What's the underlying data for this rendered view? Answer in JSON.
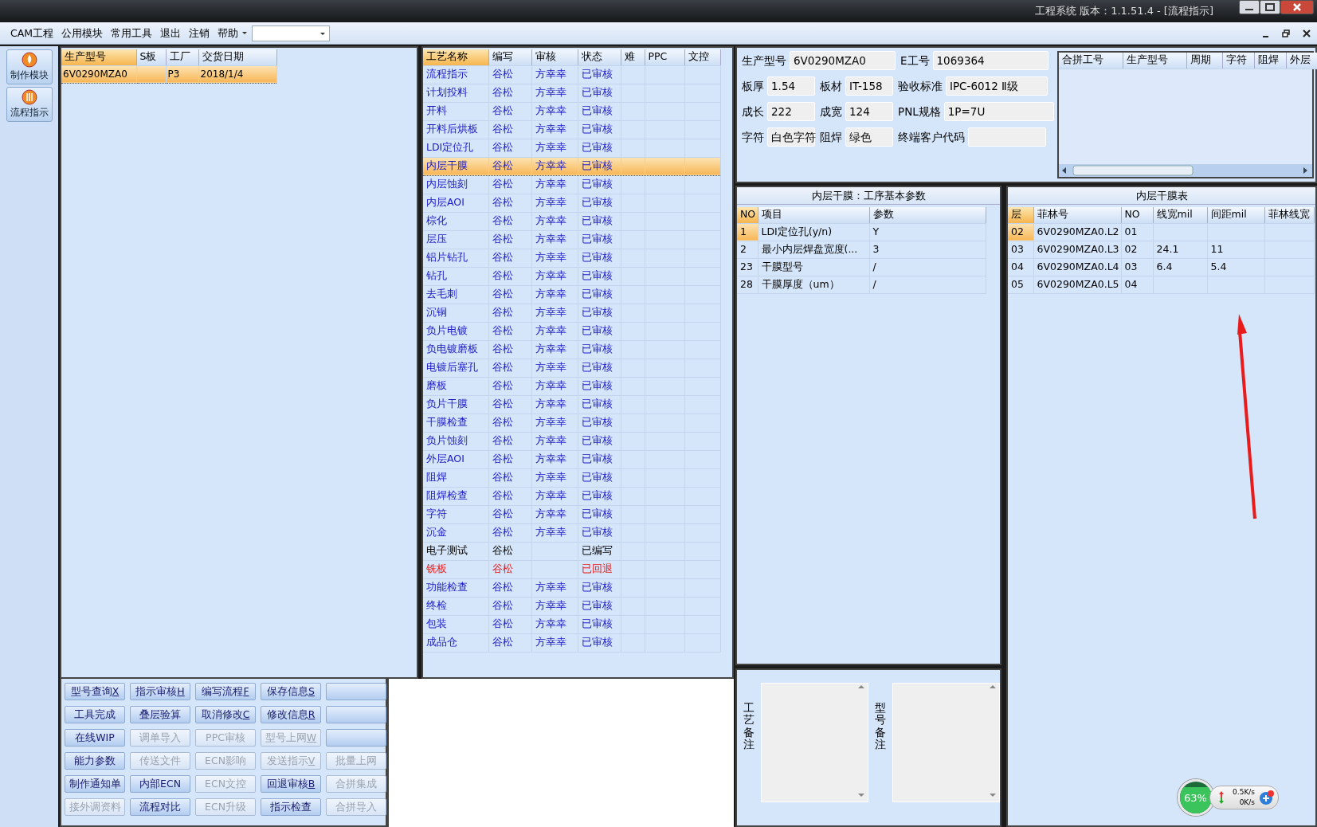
{
  "window": {
    "title": "工程系统   版本：1.1.51.4 - [流程指示]"
  },
  "menu": [
    {
      "label": "CAM工程"
    },
    {
      "label": "公用模块"
    },
    {
      "label": "常用工具"
    },
    {
      "label": "退出"
    },
    {
      "label": "注销"
    },
    {
      "label": "帮助"
    }
  ],
  "sidebar": [
    {
      "label": "制作模块"
    },
    {
      "label": "流程指示"
    }
  ],
  "orders": {
    "columns": [
      "生产型号",
      "S板",
      "工厂",
      "交货日期"
    ],
    "rows": [
      {
        "cells": [
          "6V0290MZA0",
          null,
          "P3",
          "2018/1/4"
        ],
        "selected": true
      }
    ]
  },
  "process": {
    "columns": [
      "工艺名称",
      "编写",
      "审核",
      "状态",
      "难",
      "PPC",
      "文控"
    ],
    "rows": [
      {
        "name": "流程指示",
        "author": "谷松",
        "reviewer": "方幸幸",
        "status": "已审核",
        "kind": "approved",
        "selected": false
      },
      {
        "name": "计划投料",
        "author": "谷松",
        "reviewer": "方幸幸",
        "status": "已审核",
        "kind": "approved",
        "selected": false
      },
      {
        "name": "开料",
        "author": "谷松",
        "reviewer": "方幸幸",
        "status": "已审核",
        "kind": "approved",
        "selected": false
      },
      {
        "name": "开料后烘板",
        "author": "谷松",
        "reviewer": "方幸幸",
        "status": "已审核",
        "kind": "approved",
        "selected": false
      },
      {
        "name": "LDI定位孔",
        "author": "谷松",
        "reviewer": "方幸幸",
        "status": "已审核",
        "kind": "approved",
        "selected": false
      },
      {
        "name": "内层干膜",
        "author": "谷松",
        "reviewer": "方幸幸",
        "status": "已审核",
        "kind": "approved",
        "selected": true
      },
      {
        "name": "内层蚀刻",
        "author": "谷松",
        "reviewer": "方幸幸",
        "status": "已审核",
        "kind": "approved",
        "selected": false
      },
      {
        "name": "内层AOI",
        "author": "谷松",
        "reviewer": "方幸幸",
        "status": "已审核",
        "kind": "approved",
        "selected": false
      },
      {
        "name": "棕化",
        "author": "谷松",
        "reviewer": "方幸幸",
        "status": "已审核",
        "kind": "approved",
        "selected": false
      },
      {
        "name": "层压",
        "author": "谷松",
        "reviewer": "方幸幸",
        "status": "已审核",
        "kind": "approved",
        "selected": false
      },
      {
        "name": "铝片钻孔",
        "author": "谷松",
        "reviewer": "方幸幸",
        "status": "已审核",
        "kind": "approved",
        "selected": false
      },
      {
        "name": "钻孔",
        "author": "谷松",
        "reviewer": "方幸幸",
        "status": "已审核",
        "kind": "approved",
        "selected": false
      },
      {
        "name": "去毛刺",
        "author": "谷松",
        "reviewer": "方幸幸",
        "status": "已审核",
        "kind": "approved",
        "selected": false
      },
      {
        "name": "沉铜",
        "author": "谷松",
        "reviewer": "方幸幸",
        "status": "已审核",
        "kind": "approved",
        "selected": false
      },
      {
        "name": "负片电镀",
        "author": "谷松",
        "reviewer": "方幸幸",
        "status": "已审核",
        "kind": "approved",
        "selected": false
      },
      {
        "name": "负电镀磨板",
        "author": "谷松",
        "reviewer": "方幸幸",
        "status": "已审核",
        "kind": "approved",
        "selected": false
      },
      {
        "name": "电镀后塞孔",
        "author": "谷松",
        "reviewer": "方幸幸",
        "status": "已审核",
        "kind": "approved",
        "selected": false
      },
      {
        "name": "磨板",
        "author": "谷松",
        "reviewer": "方幸幸",
        "status": "已审核",
        "kind": "approved",
        "selected": false
      },
      {
        "name": "负片干膜",
        "author": "谷松",
        "reviewer": "方幸幸",
        "status": "已审核",
        "kind": "approved",
        "selected": false
      },
      {
        "name": "干膜检查",
        "author": "谷松",
        "reviewer": "方幸幸",
        "status": "已审核",
        "kind": "approved",
        "selected": false
      },
      {
        "name": "负片蚀刻",
        "author": "谷松",
        "reviewer": "方幸幸",
        "status": "已审核",
        "kind": "approved",
        "selected": false
      },
      {
        "name": "外层AOI",
        "author": "谷松",
        "reviewer": "方幸幸",
        "status": "已审核",
        "kind": "approved",
        "selected": false
      },
      {
        "name": "阻焊",
        "author": "谷松",
        "reviewer": "方幸幸",
        "status": "已审核",
        "kind": "approved",
        "selected": false
      },
      {
        "name": "阻焊检查",
        "author": "谷松",
        "reviewer": "方幸幸",
        "status": "已审核",
        "kind": "approved",
        "selected": false
      },
      {
        "name": "字符",
        "author": "谷松",
        "reviewer": "方幸幸",
        "status": "已审核",
        "kind": "approved",
        "selected": false
      },
      {
        "name": "沉金",
        "author": "谷松",
        "reviewer": "方幸幸",
        "status": "已审核",
        "kind": "approved",
        "selected": false
      },
      {
        "name": "电子测试",
        "author": "谷松",
        "status": "已编写",
        "kind": "written",
        "selected": false
      },
      {
        "name": "铣板",
        "author": "谷松",
        "status": "已回退",
        "kind": "returned",
        "selected": false
      },
      {
        "name": "功能检查",
        "author": "谷松",
        "reviewer": "方幸幸",
        "status": "已审核",
        "kind": "approved",
        "selected": false
      },
      {
        "name": "终检",
        "author": "谷松",
        "reviewer": "方幸幸",
        "status": "已审核",
        "kind": "approved",
        "selected": false
      },
      {
        "name": "包装",
        "author": "谷松",
        "reviewer": "方幸幸",
        "status": "已审核",
        "kind": "approved",
        "selected": false
      },
      {
        "name": "成品仓",
        "author": "谷松",
        "reviewer": "方幸幸",
        "status": "已审核",
        "kind": "approved",
        "selected": false
      }
    ]
  },
  "info_rows": [
    [
      {
        "label": "生产型号",
        "value": "6V0290MZA0"
      },
      {
        "label": "E工号",
        "value": "1069364"
      }
    ],
    [
      {
        "label": "板厚",
        "value": "1.54"
      },
      {
        "label": "板材",
        "value": "IT-158"
      },
      {
        "label": "验收标准",
        "value": "IPC-6012 Ⅱ级"
      }
    ],
    [
      {
        "label": "成长",
        "value": "222"
      },
      {
        "label": "成宽",
        "value": "124"
      },
      {
        "label": "PNL规格",
        "value": "1P=7U"
      }
    ],
    [
      {
        "label": "字符",
        "value": "白色字符"
      },
      {
        "label": "阻焊",
        "value": "绿色"
      },
      {
        "label": "终端客户代码"
      }
    ]
  ],
  "merge_table": {
    "columns": [
      "合拼工号",
      "生产型号",
      "周期",
      "字符",
      "阻焊",
      "外层"
    ]
  },
  "params_panel": {
    "title": "内层干膜：工序基本参数",
    "columns": [
      "NO",
      "项目",
      "参数"
    ],
    "rows": [
      {
        "cells": [
          "1",
          "LDI定位孔(y/n)",
          "Y"
        ],
        "selected": true
      },
      {
        "cells": [
          "2",
          "最小内层焊盘宽度(...",
          "3"
        ],
        "selected": false
      },
      {
        "cells": [
          "23",
          "干膜型号",
          "/"
        ],
        "selected": false
      },
      {
        "cells": [
          "28",
          "干膜厚度（um）",
          "/"
        ],
        "selected": false
      }
    ]
  },
  "layers_panel": {
    "title": "内层干膜表",
    "columns": [
      "层",
      "菲林号",
      "NO",
      "线宽mil",
      "间距mil",
      "菲林线宽"
    ],
    "rows": [
      {
        "cells": [
          "02",
          "6V0290MZA0.L2",
          "01",
          null,
          null,
          null
        ],
        "selected": true
      },
      {
        "cells": [
          "03",
          "6V0290MZA0.L3",
          "02",
          "24.1",
          "11",
          null
        ],
        "selected": false
      },
      {
        "cells": [
          "04",
          "6V0290MZA0.L4",
          "03",
          "6.4",
          "5.4",
          null
        ],
        "selected": false
      },
      {
        "cells": [
          "05",
          "6V0290MZA0.L5",
          "04",
          null,
          null,
          null
        ],
        "selected": false
      }
    ]
  },
  "notes": [
    {
      "label": "工艺备注"
    },
    {
      "label": "型号备注"
    }
  ],
  "buttons": [
    {
      "label": "型号查询",
      "hotkey": "X",
      "enabled": true
    },
    {
      "label": "指示审核",
      "hotkey": "H",
      "enabled": true
    },
    {
      "label": "编写流程",
      "hotkey": "F",
      "enabled": true
    },
    {
      "label": "保存信息",
      "hotkey": "S",
      "enabled": true
    },
    {
      "enabled": true
    },
    {
      "label": "工具完成",
      "enabled": true
    },
    {
      "label": "叠层验算",
      "enabled": true
    },
    {
      "label": "取消修改",
      "hotkey": "C",
      "enabled": true
    },
    {
      "label": "修改信息",
      "hotkey": "R",
      "enabled": true
    },
    {
      "enabled": true
    },
    {
      "label": "在线WIP",
      "enabled": true
    },
    {
      "label": "调单导入",
      "enabled": false
    },
    {
      "label": "PPC审核",
      "enabled": false
    },
    {
      "label": "型号上网",
      "hotkey": "W",
      "enabled": false
    },
    {
      "enabled": true
    },
    {
      "label": "能力参数",
      "enabled": true
    },
    {
      "label": "传送文件",
      "enabled": false
    },
    {
      "label": "ECN影响",
      "enabled": false
    },
    {
      "label": "发送指示",
      "hotkey": "V",
      "enabled": false
    },
    {
      "label": "批量上网",
      "enabled": false
    },
    {
      "label": "制作通知单",
      "enabled": true
    },
    {
      "label": "内部ECN",
      "enabled": true
    },
    {
      "label": "ECN文控",
      "enabled": false
    },
    {
      "label": "回退审核",
      "hotkey": "B",
      "enabled": true
    },
    {
      "label": "合拼集成",
      "enabled": false
    },
    {
      "label": "接外调资料",
      "enabled": false
    },
    {
      "label": "流程对比",
      "enabled": true
    },
    {
      "label": "ECN升级",
      "enabled": false
    },
    {
      "label": "指示检查",
      "enabled": true
    },
    {
      "label": "合拼导入",
      "enabled": false
    }
  ],
  "net_widget": {
    "percent": "63%",
    "upload": "0.5K/s",
    "download": "0K/s"
  }
}
